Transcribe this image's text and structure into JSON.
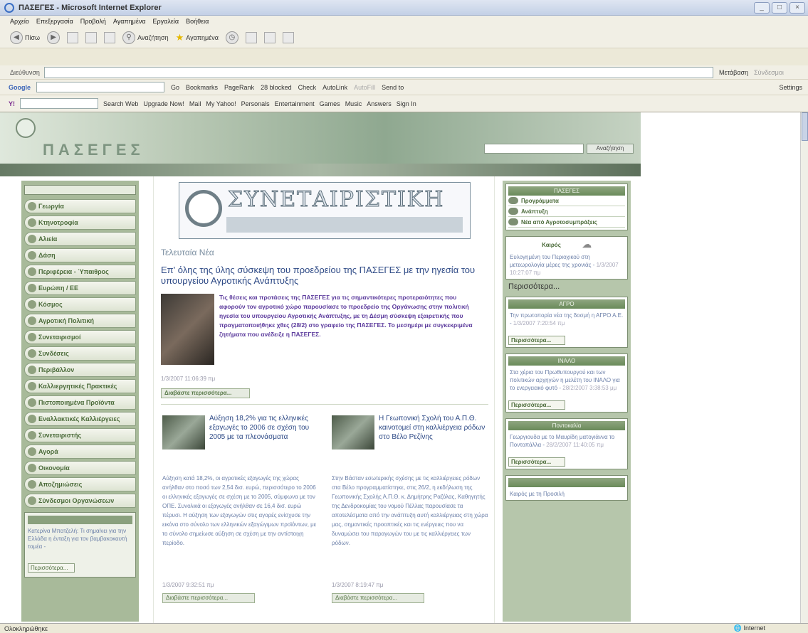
{
  "window": {
    "title": "ΠΑΣΕΓΕΣ - Microsoft Internet Explorer",
    "buttons": [
      "_",
      "□",
      "×"
    ]
  },
  "menu": [
    "Αρχείο",
    "Επεξεργασία",
    "Προβολή",
    "Αγαπημένα",
    "Εργαλεία",
    "Βοήθεια"
  ],
  "toolbar": {
    "back_label": "Πίσω",
    "search_label": "Αναζήτηση",
    "favorites_label": "Αγαπημένα"
  },
  "address": {
    "label": "Διεύθυνση",
    "go_label": "Μετάβαση",
    "links_label": "Σύνδεσμοι"
  },
  "google": {
    "label": "Google",
    "go": "Go",
    "items": [
      "Bookmarks",
      "PageRank",
      "28 blocked",
      "Check",
      "AutoLink",
      "AutoFill",
      "Send to",
      "Settings"
    ]
  },
  "yahoo": {
    "search_label": "Search Web",
    "items": [
      "Upgrade Now!",
      "Mail",
      "My Yahoo!",
      "Personals",
      "Entertainment",
      "Games",
      "Music",
      "Answers",
      "Sign In"
    ]
  },
  "status": {
    "text": "Ολοκληρώθηκε",
    "zone": "Internet"
  },
  "site": {
    "search_button": "Αναζήτηση",
    "nav": [
      "Γεωργία",
      "Κτηνοτροφία",
      "Αλιεία",
      "Δάση",
      "Περιφέρεια - Ύπαιθρος",
      "Ευρώπη / ΕΕ",
      "Κόσμος",
      "Αγροτική Πολιτική",
      "Συνεταιρισμοί",
      "Συνδέσεις",
      "Περιβάλλον",
      "Καλλιεργητικές Πρακτικές",
      "Πιστοποιημένα Προϊόντα",
      "Εναλλακτικές Καλλιέργειες",
      "Συνεταιριστής",
      "Αγορά",
      "Οικονομία",
      "Αποζημιώσεις",
      "Σύνδεσμοι Οργανώσεων"
    ],
    "left_box": {
      "text": "Κατερίνα Μπατζελή: Τι σημαίνει για την Ελλάδα η ένταξη για τον βαμβακοκαυτή τομέα -",
      "more": "Περισσότερα..."
    },
    "coop_banner": "ΣΥΝΕΤΑΙΡΙΣΤΙΚΗ",
    "latest_label": "Τελευταία Νέα",
    "headline": "Επ' όλης της ύλης σύσκεψη του προεδρείου της ΠΑΣΕΓΕΣ με την ηγεσία του υπουργείου Αγροτικής Ανάπτυξης",
    "lead": "Τις θέσεις και προτάσεις της ΠΑΣΕΓΕΣ για τις σημαντικότερες προτεραιότητες που αφορούν τον αγροτικό χώρο παρουσίασε το προεδρείο της Οργάνωσης στην πολιτική ηγεσία του υπουργείου Αγροτικής Ανάπτυξης, με τη Δέσμη σύσκεψη εξαιρετικής που πραγματοποιήθηκε χθες (28/2) στο γραφείο της ΠΑΣΕΓΕΣ. Το μεσημέρι με συγκεκριμένα ζητήματα που ανέδειξε η ΠΑΣΕΓΕΣ.",
    "lead_date": "1/3/2007 11:06:39 πμ",
    "read_more": "Διαβάστε περισσότερα...",
    "news": [
      {
        "title": "Αύξηση 18,2% για τις ελληνικές εξαγωγές το 2006 σε σχέση του 2005 με τα πλεονάσματα",
        "body": "Αύξηση κατά 18,2%, οι αγροτικές εξαγωγές της χώρας ανήλθαν στο ποσό των 2,54 δισ. ευρώ, περισσότερο το 2006 οι ελληνικές εξαγωγές σε σχέση με το 2005, σύμφωνα με τον ΟΠΕ. Συνολικά οι εξαγωγές ανήλθαν σε 16,4 δισ. ευρώ πέρυσι. Η αύξηση των εξαγωγών στις αγορές ενίσχυσε την εικόνα στο σύνολο των ελληνικών εξαγώγιμων προϊόντων, με το σύνολο σημείωσε αύξηση σε σχέση με την αντίστοιχη περίοδο.",
        "date": "1/3/2007 9:32:51 πμ",
        "more": "Διαβάστε περισσότερα..."
      },
      {
        "title": "Η Γεωπονική Σχολή του Α.Π.Θ. καινοτομεί στη καλλιέργεια ρόδων στο Βέλο Ρεζίνης",
        "body": "Στην Βάσταν εσωτερικής σχέσης με τις καλλιέργειες ρόδων στα Βέλο προγραμματίστηκε, στις 26/2, η εκδήλωση της Γεωπονικής Σχολής Α.Π.Θ. κ. Δημήτρης Ραζόλας, Καθηγητής της Δενδροκομίας του νομού Πέλλας παρουσίασε τα αποτελέσματα από την ανάπτυξη αυτή καλλιέργειας στη χώρα μας, σημαντικές προοπτικές και τις ενέργειες που να δυναμώσει του παραγωγών του με τις καλλιέργειες των ρόδων.",
        "date": "1/3/2007 8:19:47 πμ",
        "more": "Διαβάστε περισσότερα..."
      }
    ],
    "right": {
      "pasegés_title": "ΠΑΣΕΓΕΣ",
      "pasegés_links": [
        "Προγράμματα",
        "Ανάπτυξη",
        "Νέα από Αγροτοσυμπράξεις"
      ],
      "kairos_title": "Καιρός",
      "kairos_text": "Ευλογημένη του Περιοχικού στη μετεωρολογία μέρες της χρονιάς -",
      "kairos_date": "1/3/2007 10:27:07 πμ",
      "agro_title": "ΑΓΡΟ",
      "agro_text": "Την πρωτοπορία νέα της δοσμή η ΑΓΡΟ Α.Ε. -",
      "agro_date": "1/3/2007 7:20:54 πμ",
      "inalo_title": "ΙΝΑΛΟ",
      "inalo_text": "Στα χέρια του Πρωθυπουργού και των πολιτικών αρχηγών η μελέτη του ΙΝΑΛΟ για το ενεργειακό φυτό -",
      "inalo_date": "28/2/2007 3:38:53 μμ",
      "pontos_title": "Ποντοκαλία",
      "pontos_text": "Γεωργιουδα με το Μαυρίδη ματογιάννα το Ποντοπάλλα -",
      "pontos_date": "28/2/2007 11:40:05 πμ",
      "more": "Περισσότερα...",
      "last_text": "Καιρός με τη Προσιλή"
    }
  }
}
